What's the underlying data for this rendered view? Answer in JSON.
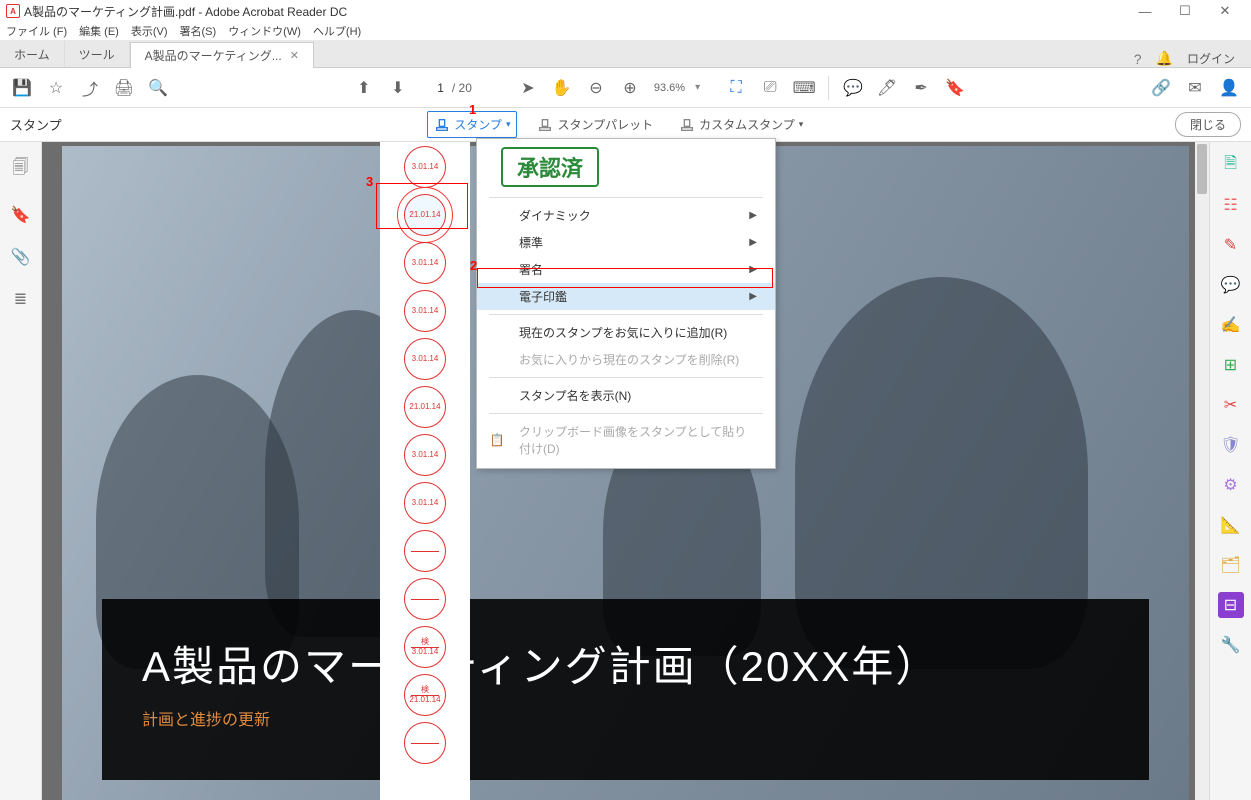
{
  "window": {
    "title": "A製品のマーケティング計画.pdf - Adobe Acrobat Reader DC"
  },
  "menubar": {
    "file": "ファイル (F)",
    "edit": "編集 (E)",
    "view": "表示(V)",
    "sign": "署名(S)",
    "window": "ウィンドウ(W)",
    "help": "ヘルプ(H)"
  },
  "tabs": {
    "home": "ホーム",
    "tools": "ツール",
    "doc": "A製品のマーケティング...",
    "login": "ログイン"
  },
  "toolbar": {
    "page_current": "1",
    "page_total": "/ 20",
    "zoom": "93.6%"
  },
  "stampbar": {
    "label": "スタンプ",
    "stamp_btn": "スタンプ",
    "palette_btn": "スタンプパレット",
    "custom_btn": "カスタムスタンプ",
    "close": "閉じる"
  },
  "annotations": {
    "n1": "1",
    "n2": "2",
    "n3": "3"
  },
  "dropdown": {
    "approved": "承認済",
    "dynamic": "ダイナミック",
    "standard": "標準",
    "signature": "署名",
    "eseal": "電子印鑑",
    "fav_add": "現在のスタンプをお気に入りに追加(R)",
    "fav_remove": "お気に入りから現在のスタンプを削除(R)",
    "show_name": "スタンプ名を表示(N)",
    "clipboard": "クリップボード画像をスタンプとして貼り付け(D)"
  },
  "stamps": [
    {
      "text": "3.01.14"
    },
    {
      "text": "21.01.14",
      "selected": true
    },
    {
      "text": "3.01.14"
    },
    {
      "text": "3.01.14"
    },
    {
      "text": "3.01.14"
    },
    {
      "text": "21.01.14"
    },
    {
      "text": "3.01.14"
    },
    {
      "text": "3.01.14"
    },
    {
      "text": ""
    },
    {
      "text": ""
    },
    {
      "top": "検",
      "text": "3.01.14"
    },
    {
      "top": "検",
      "text": "21.01.14"
    },
    {
      "text": ""
    }
  ],
  "document": {
    "title": "A製品のマーケティング計画（20XX年）",
    "subtitle": "計画と進捗の更新"
  }
}
